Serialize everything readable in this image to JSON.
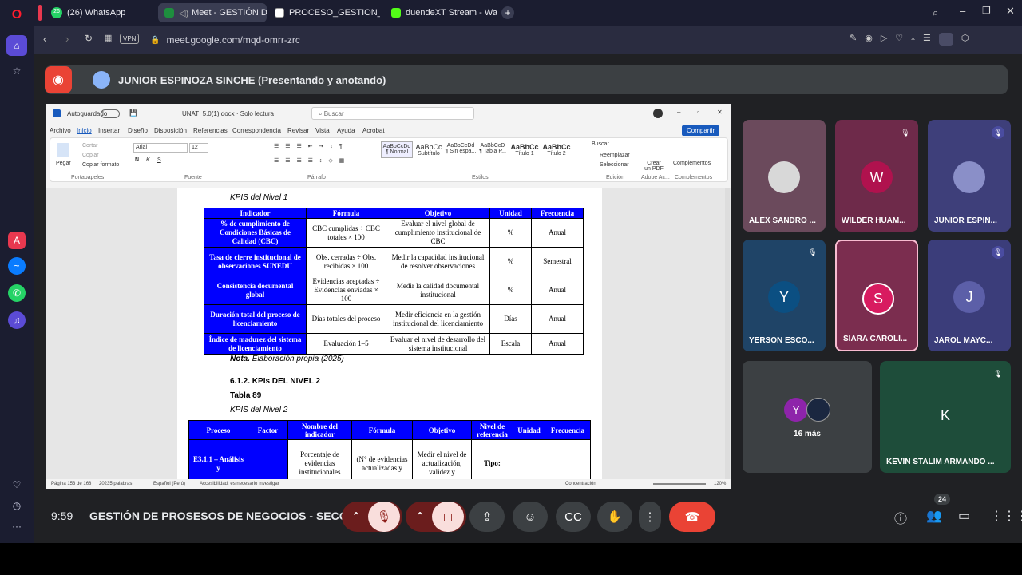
{
  "browser": {
    "tabs": [
      {
        "label": "(26) WhatsApp",
        "badge": "26"
      },
      {
        "label": "Meet - GESTIÓN D"
      },
      {
        "label": "PROCESO_GESTION_DE_C"
      },
      {
        "label": "duendeXT Stream - Watch"
      }
    ],
    "vpn_label": "VPN",
    "url": "meet.google.com/mqd-omrr-zrc"
  },
  "meet": {
    "presenter": "JUNIOR ESPINOZA SINCHE (Presentando y anotando)",
    "time": "9:59",
    "meeting_title": "GESTIÓN DE PROSESOS DE NEGOCIOS - SECCI...",
    "people_count": "24"
  },
  "word": {
    "autosave_label": "Autoguardado",
    "filename": "UNAT_5.0(1).docx · Solo lectura",
    "search_placeholder": "Buscar",
    "menu": [
      "Archivo",
      "Inicio",
      "Insertar",
      "Diseño",
      "Disposición",
      "Referencias",
      "Correspondencia",
      "Revisar",
      "Vista",
      "Ayuda",
      "Acrobat"
    ],
    "share_label": "Compartir",
    "font_name": "Arial",
    "font_size": "12",
    "clipboard": {
      "paste": "Pegar",
      "cut": "Cortar",
      "copy": "Copiar",
      "format": "Copiar formato",
      "group": "Portapapeles"
    },
    "groups": {
      "font": "Fuente",
      "paragraph": "Párrafo",
      "styles": "Estilos",
      "edit": "Edición",
      "adobe": "Adobe Ac...",
      "addins": "Complementos"
    },
    "styles": [
      {
        "preview": "AaBbCcDd",
        "name": "¶ Normal"
      },
      {
        "preview": "AaBbCc",
        "name": "Subtítulo"
      },
      {
        "preview": "AaBbCcDd",
        "name": "¶ Sin espa..."
      },
      {
        "preview": "AaBbCcD",
        "name": "¶ Tabla P..."
      },
      {
        "preview": "AaBbCc",
        "name": "Título 1"
      },
      {
        "preview": "AaBbCc",
        "name": "Título 2"
      }
    ],
    "edit_tools": [
      "Buscar",
      "Reemplazar",
      "Seleccionar"
    ],
    "create_pdf": "Crear un PDF",
    "complements": "Complementos",
    "status": {
      "page": "Página 153 de 168",
      "words": "20235 palabras",
      "lang": "Español (Perú)",
      "access": "Accesibilidad: es necesario investigar",
      "focus": "Concentración",
      "zoom": "120%"
    }
  },
  "doc": {
    "caption1": "KPIS del Nivel 1",
    "table1_headers": [
      "Indicador",
      "Fórmula",
      "Objetivo",
      "Unidad",
      "Frecuencia"
    ],
    "table1_rows": [
      [
        "% de cumplimiento de Condiciones Básicas de Calidad (CBC)",
        "CBC cumplidas ÷ CBC totales × 100",
        "Evaluar el nivel global de cumplimiento institucional de CBC",
        "%",
        "Anual"
      ],
      [
        "Tasa de cierre institucional de observaciones SUNEDU",
        "Obs. cerradas ÷ Obs. recibidas × 100",
        "Medir la capacidad institucional de resolver observaciones",
        "%",
        "Semestral"
      ],
      [
        "Consistencia documental global",
        "Evidencias aceptadas ÷ Evidencias enviadas × 100",
        "Medir la calidad documental institucional",
        "%",
        "Anual"
      ],
      [
        "Duración total del proceso de licenciamiento",
        "Días totales del proceso",
        "Medir eficiencia en la gestión institucional del licenciamiento",
        "Días",
        "Anual"
      ],
      [
        "Índice de madurez del sistema de licenciamiento",
        "Evaluación 1–5",
        "Evaluar el nivel de desarrollo del sistema institucional",
        "Escala",
        "Anual"
      ]
    ],
    "nota_label": "Nota.",
    "nota_text": " Elaboración propia (2025)",
    "section_heading": "6.1.2. KPIs DEL NIVEL 2",
    "table_number": "Tabla 89",
    "caption2": "KPIS del Nivel 2",
    "table2_headers": [
      "Proceso",
      "Factor",
      "Nombre del indicador",
      "Fórmula",
      "Objetivo",
      "Nivel de referencia",
      "Unidad",
      "Frecuencia"
    ],
    "table2_row": [
      "E3.1.1 – Análisis y",
      "",
      "Porcentaje de evidencias institucionales",
      "(N° de evidencias actualizadas y",
      "Medir el nivel de actualización, validez y",
      "Tipo:",
      "",
      ""
    ]
  },
  "participants": [
    {
      "name": "ALEX SANDRO ...",
      "color": "#6b4a5c",
      "muted": false,
      "initial": ""
    },
    {
      "name": "WILDER HUAM...",
      "color": "#6e2a4a",
      "muted": true,
      "initial": "W",
      "avatar_color": "#b0124e"
    },
    {
      "name": "JUNIOR ESPIN...",
      "color": "#3e3f7a",
      "muted": true,
      "initial": ""
    },
    {
      "name": "YERSON ESCO...",
      "color": "#1f4467",
      "muted": true,
      "initial": "Y",
      "avatar_color": "#0b4f82"
    },
    {
      "name": "SIARA CAROLI...",
      "color": "#7b2d4f",
      "muted": false,
      "initial": "S",
      "avatar_color": "#d81b60"
    },
    {
      "name": "JAROL MAYC...",
      "color": "#3b3d7a",
      "muted": true,
      "initial": "J",
      "avatar_color": "#5c5fa8"
    },
    {
      "name": "16 más",
      "color": "#3c4043",
      "muted": false,
      "initial": "Y",
      "avatar_color": "#8e24aa"
    },
    {
      "name": "KEVIN STALIM ARMANDO ...",
      "color": "#1e4d3a",
      "muted": true,
      "initial": "K",
      "avatar_color": "#1e4d3a"
    }
  ]
}
